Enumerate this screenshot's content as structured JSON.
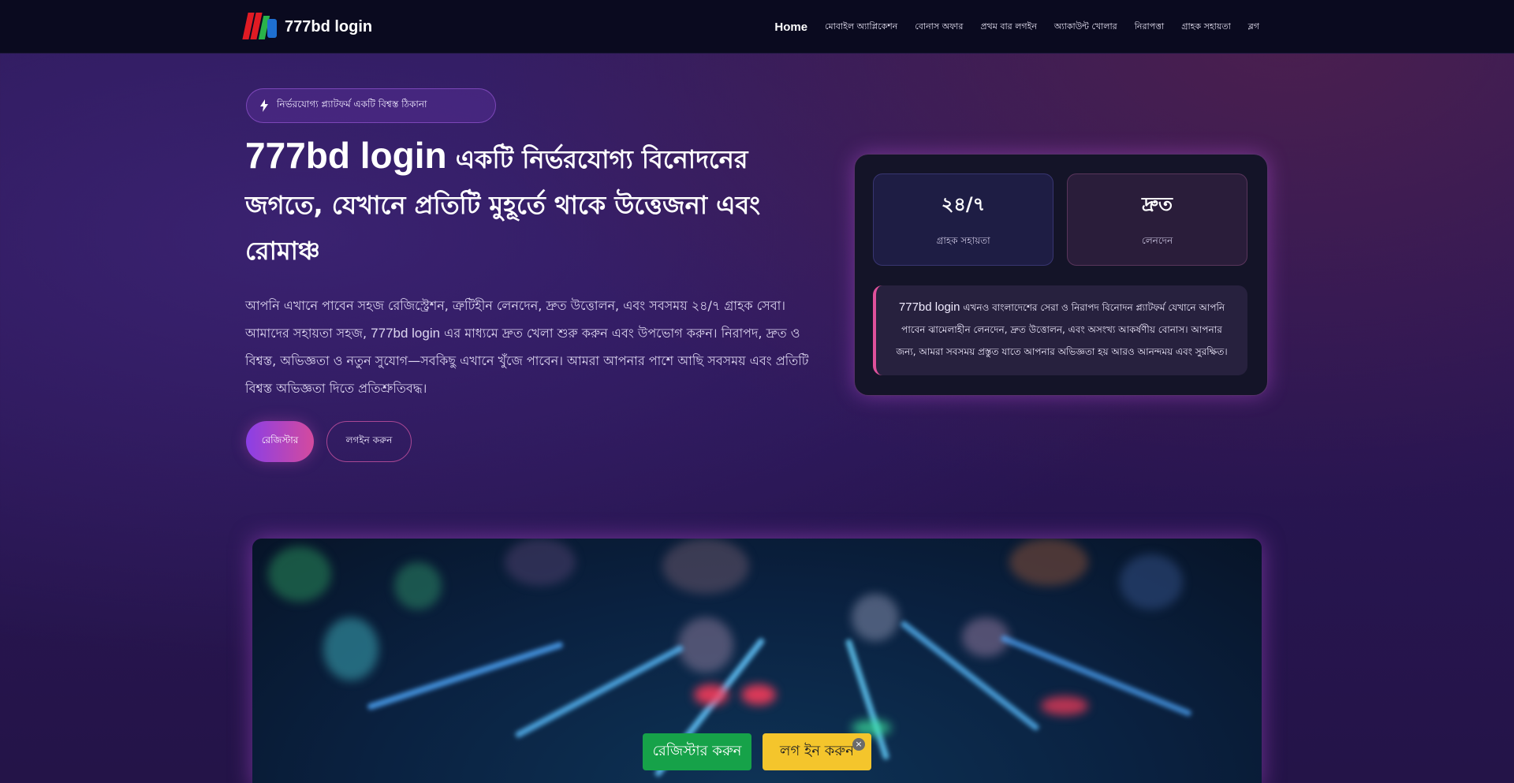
{
  "header": {
    "brand_name": "777bd login",
    "nav": [
      {
        "label": "Home"
      },
      {
        "label": "মোবাইল অ্যাপ্লিকেশন"
      },
      {
        "label": "বোনাস অফার"
      },
      {
        "label": "প্রথম বার লগইন"
      },
      {
        "label": "অ্যাকাউন্ট খোলার"
      },
      {
        "label": "নিরাপত্তা"
      },
      {
        "label": "গ্রাহক সহায়তা"
      },
      {
        "label": "ব্লগ"
      }
    ]
  },
  "hero": {
    "badge_text": "নির্ভরযোগ্য প্ল্যাটফর্ম একটি বিশ্বস্ত ঠিকানা",
    "title_lead": "777bd login",
    "title_rest": "একটি নির্ভরযোগ্য বিনোদনের জগতে, যেখানে প্রতিটি মুহূর্তে থাকে উত্তেজনা এবং রোমাঞ্চ",
    "desc_part1": "আপনি এখানে পাবেন সহজ রেজিস্ট্রেশন, ত্রুটিহীন লেনদেন, দ্রুত উত্তোলন, এবং সবসময় ২৪/৭ গ্রাহক সেবা। আমাদের সহায়তা সহজ,",
    "desc_latin": "777bd login",
    "desc_part2": "এর মাধ্যমে দ্রুত খেলা শুরু করুন এবং উপভোগ করুন। নিরাপদ, দ্রুত ও বিশ্বস্ত, অভিজ্ঞতা ও নতুন সুযোগ—সবকিছু এখানে খুঁজে পাবেন। আমরা আপনার পাশে আছি সবসময় এবং প্রতিটি বিশ্বস্ত অভিজ্ঞতা দিতে প্রতিশ্রুতিবদ্ধ।",
    "primary_button": "রেজিস্টার",
    "secondary_button": "লগইন করুন"
  },
  "card": {
    "stats": [
      {
        "value": "২৪/৭",
        "label": "গ্রাহক সহায়তা"
      },
      {
        "value": "দ্রুত",
        "label": "লেনদেন"
      }
    ],
    "quote_latin": "777bd login",
    "quote_text": "এখনও বাংলাদেশের সেরা ও নিরাপদ বিনোদন প্ল্যাটফর্ম যেখানে আপনি পাবেন ঝামেলাহীন লেনদেন, দ্রুত উত্তোলন, এবং অসংখ্য আকর্ষণীয় বোনাস। আপনার জন্য, আমরা সবসময় প্রস্তুত যাতে আপনার অভিজ্ঞতা হয় আরও আনন্দময় এবং সুরক্ষিত।"
  },
  "floating": {
    "green_button": "রেজিস্টার করুন",
    "yellow_button": "লগ ইন করুন",
    "close_glyph": "×"
  }
}
